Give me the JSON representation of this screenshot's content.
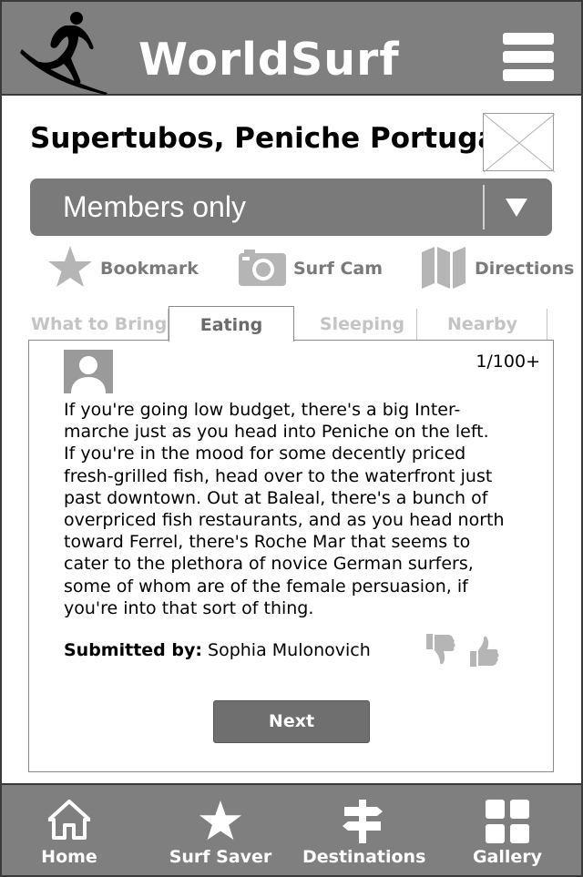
{
  "header": {
    "brand": "WorldSurf",
    "logo_icon": "surfer-logo-icon",
    "menu_icon": "hamburger-menu-icon"
  },
  "spot": {
    "title": "Supertubos, Peniche Portugal",
    "image_icon": "image-placeholder-icon"
  },
  "access_select": {
    "value": "Members only",
    "arrow_icon": "chevron-down-icon"
  },
  "actions": [
    {
      "label": "Bookmark",
      "icon": "star-icon"
    },
    {
      "label": "Surf Cam",
      "icon": "camera-icon"
    },
    {
      "label": "Directions",
      "icon": "map-icon"
    }
  ],
  "tabs": [
    {
      "label": "What to Bring",
      "active": false
    },
    {
      "label": "Eating",
      "active": true
    },
    {
      "label": "Sleeping",
      "active": false
    },
    {
      "label": "Nearby",
      "active": false
    }
  ],
  "review": {
    "counter": "1/100+",
    "lines": [
      "If you're going low budget, there's a big Inter-",
      "marche just as you head into Peniche on the left.",
      "If you're in the mood for some decently priced",
      "fresh-grilled fish, head over to the waterfront just",
      "past downtown. Out at Baleal, there's a bunch of",
      "overpriced fish restaurants, and as you head north",
      "toward Ferrel, there's Roche Mar that seems to",
      "cater to the plethora of novice German surfers,",
      "some of whom are of the female persuasion, if",
      "you're into that sort of thing."
    ],
    "submitted_label": "Submitted by:",
    "author": " Sophia Mulonovich",
    "next_label": "Next"
  },
  "footer": {
    "items": [
      {
        "label": "Home",
        "icon": "home-icon"
      },
      {
        "label": "Surf Saver",
        "icon": "star-icon"
      },
      {
        "label": "Destinations",
        "icon": "signpost-icon"
      },
      {
        "label": "Gallery",
        "icon": "grid-icon"
      }
    ]
  },
  "colors": {
    "bar_gray": "#7f7f7f",
    "icon_gray": "#b5b5b5",
    "inactive_tab": "#c4c4c4"
  }
}
